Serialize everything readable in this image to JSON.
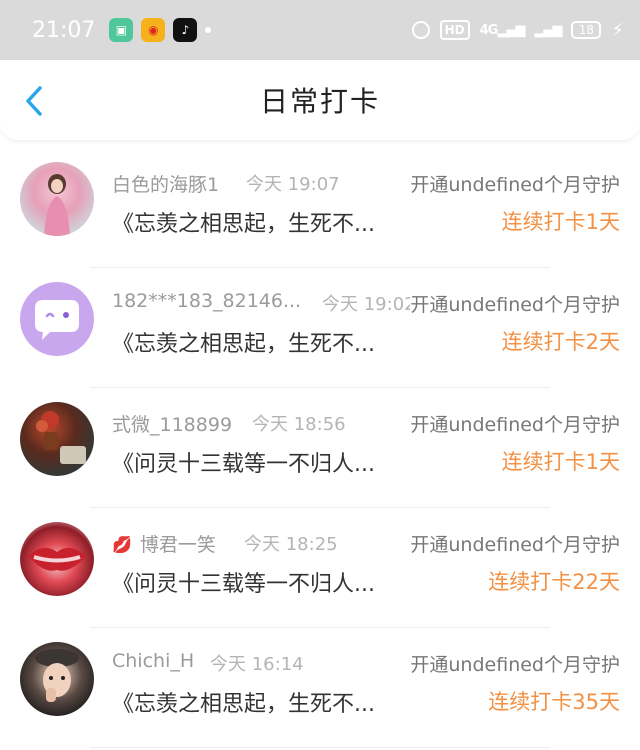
{
  "status_bar": {
    "time": "21:07",
    "hd_label": "HD",
    "network_label": "4G",
    "battery": "18"
  },
  "nav": {
    "title": "日常打卡"
  },
  "items": [
    {
      "name": "白色的海豚1",
      "time": "今天 19:07",
      "guard": "开通undefined个月守护",
      "quote": "《忘羡之相思起，生死不...",
      "streak": "连续打卡1天"
    },
    {
      "name": "182***183_82146...",
      "time": "今天 19:02",
      "guard": "开通undefined个月守护",
      "quote": "《忘羡之相思起，生死不...",
      "streak": "连续打卡2天"
    },
    {
      "name": "式微_118899",
      "time": "今天 18:56",
      "guard": "开通undefined个月守护",
      "quote": "《问灵十三载等一不归人...",
      "streak": "连续打卡1天"
    },
    {
      "name": "博君一笑",
      "time": "今天 18:25",
      "guard": "开通undefined个月守护",
      "quote": "《问灵十三载等一不归人...",
      "streak": "连续打卡22天"
    },
    {
      "name": "Chichi_H",
      "time": "今天 16:14",
      "guard": "开通undefined个月守护",
      "quote": "《忘羡之相思起，生死不...",
      "streak": "连续打卡35天"
    }
  ],
  "colors": {
    "accent_orange": "#f39144",
    "back_blue": "#2aa4ea",
    "status_bg": "#dadadb"
  }
}
